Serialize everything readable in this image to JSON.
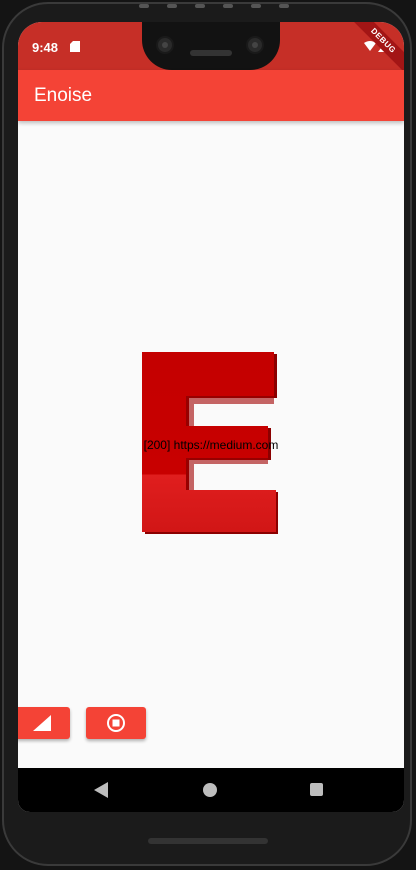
{
  "status_bar": {
    "time": "9:48"
  },
  "debug_banner": "DEBUG",
  "app_bar": {
    "title": "Enoise"
  },
  "content": {
    "logo_letter": "E",
    "status_text": "[200] https://medium.com"
  },
  "buttons": {
    "noise_icon": "signal-triangle-icon",
    "stop_icon": "stop-circle-icon"
  },
  "colors": {
    "primary": "#f44336",
    "status_bar": "#c62f27",
    "logo_red": "#cc0000"
  }
}
